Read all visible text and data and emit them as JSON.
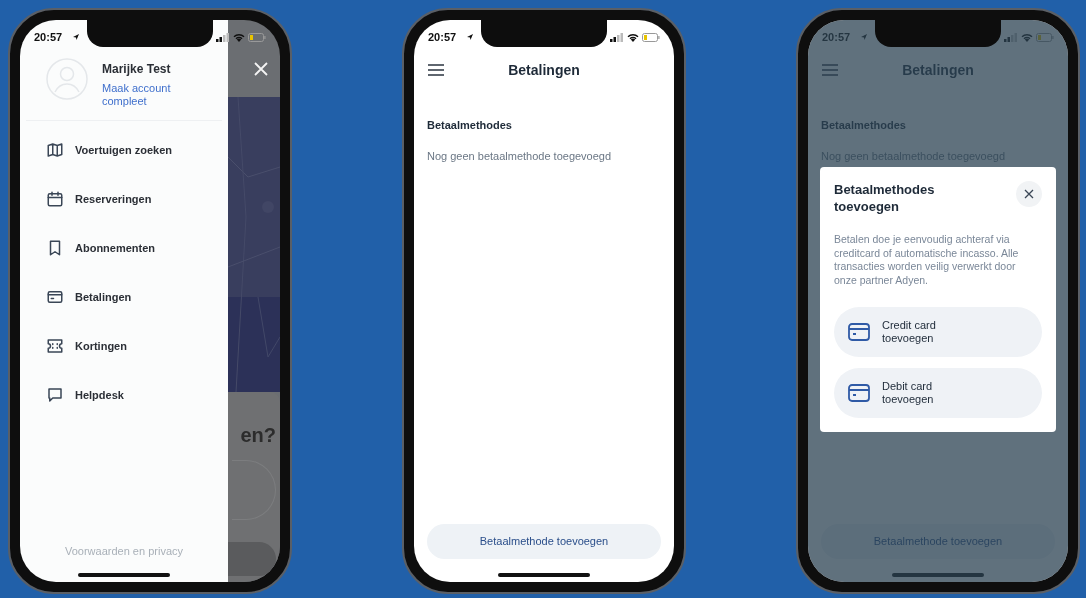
{
  "phones": [
    {
      "kind": "menu",
      "status": {
        "time": "20:57"
      },
      "profile": {
        "name": "Marijke Test",
        "link": "Maak account compleet"
      },
      "menu_items": [
        {
          "kind": "map",
          "label": "Voertuigen zoeken"
        },
        {
          "kind": "calendar",
          "label": "Reserveringen"
        },
        {
          "kind": "bookmark",
          "label": "Abonnementen"
        },
        {
          "kind": "card",
          "label": "Betalingen"
        },
        {
          "kind": "ticket",
          "label": "Kortingen"
        },
        {
          "kind": "chat",
          "label": "Helpdesk"
        }
      ],
      "footer_link": "Voorwaarden en privacy",
      "behind_sheet_title": "en?"
    },
    {
      "kind": "payments",
      "dimmed": false,
      "status": {
        "time": "20:57"
      },
      "title": "Betalingen",
      "section_title": "Betaalmethodes",
      "empty_text": "Nog geen betaalmethode toegevoegd",
      "primary_button": "Betaalmethode toevoegen"
    },
    {
      "kind": "payments",
      "dimmed": true,
      "status": {
        "time": "20:57"
      },
      "title": "Betalingen",
      "section_title": "Betaalmethodes",
      "empty_text": "Nog geen betaalmethode toegevoegd",
      "primary_button": "Betaalmethode toevoegen",
      "modal": {
        "title": "Betaalmethodes toevoegen",
        "body": "Betalen doe je eenvoudig achteraf via creditcard of automatische incasso. Alle transacties worden veilig verwerkt door onze partner Adyen.",
        "options": [
          {
            "label": "Credit card toevoegen"
          },
          {
            "label": "Debit card toevoegen"
          }
        ]
      }
    }
  ]
}
